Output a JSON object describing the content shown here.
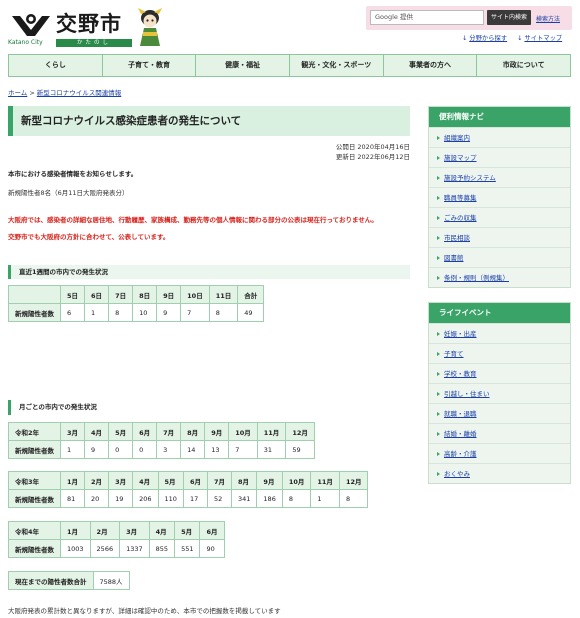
{
  "header": {
    "logo_text": "交野市",
    "logo_en": "Katano City",
    "logo_kana": "かたのし",
    "search_placeholder": "Google 提供",
    "search_button": "サイト内検索",
    "search_howto": "検索方法",
    "links": [
      "分野から探す",
      "サイトマップ"
    ]
  },
  "nav": [
    "くらし",
    "子育て・教育",
    "健康・福祉",
    "観光・文化・スポーツ",
    "事業者の方へ",
    "市政について"
  ],
  "breadcrumb": {
    "home": "ホーム",
    "sep": ">",
    "current": "新型コロナウイルス関連情報"
  },
  "page": {
    "title": "新型コロナウイルス感染症患者の発生について",
    "published": "公開日 2020年04月16日",
    "updated": "更新日 2022年06月12日",
    "lead": "本市における感染者情報をお知らせします。",
    "note": "新規陽性者8名（6月11日大阪府発表分）",
    "red1": "大阪府では、感染者の詳細な居住地、行動履歴、家族構成、勤務先等の個人情報に関わる部分の公表は現在行っておりません。",
    "red2": "交野市でも大阪府の方針に合わせて、公表しています。",
    "week_heading": "直近1週間の市内での発生状況",
    "week_table": {
      "days": [
        "5日",
        "6日",
        "7日",
        "8日",
        "9日",
        "10日",
        "11日",
        "合計"
      ],
      "label": "新規陽性者数",
      "values": [
        "6",
        "1",
        "8",
        "10",
        "9",
        "7",
        "8",
        "49"
      ]
    },
    "month_heading": "月ごとの市内での発生状況",
    "r2": {
      "year": "令和2年",
      "months": [
        "3月",
        "4月",
        "5月",
        "6月",
        "7月",
        "8月",
        "9月",
        "10月",
        "11月",
        "12月"
      ],
      "label": "新規陽性者数",
      "values": [
        "1",
        "9",
        "0",
        "0",
        "3",
        "14",
        "13",
        "7",
        "31",
        "59"
      ]
    },
    "r3": {
      "year": "令和3年",
      "months": [
        "1月",
        "2月",
        "3月",
        "4月",
        "5月",
        "6月",
        "7月",
        "8月",
        "9月",
        "10月",
        "11月",
        "12月"
      ],
      "label": "新規陽性者数",
      "values": [
        "81",
        "20",
        "19",
        "206",
        "110",
        "17",
        "52",
        "341",
        "186",
        "8",
        "1",
        "8"
      ]
    },
    "r4": {
      "year": "令和4年",
      "months": [
        "1月",
        "2月",
        "3月",
        "4月",
        "5月",
        "6月"
      ],
      "label": "新規陽性者数",
      "values": [
        "1003",
        "2566",
        "1337",
        "855",
        "551",
        "90"
      ]
    },
    "total_label": "現在までの陽性者数合計",
    "total_value": "7588人",
    "footnote": "大阪府発表の累計数と異なりますが、詳細は確認中のため、本市での把握数を掲載しています"
  },
  "sidebar": {
    "box1_title": "便利情報ナビ",
    "box1_items": [
      "組織案内",
      "施設マップ",
      "施設予約システム",
      "職員等募集",
      "ごみの収集",
      "市民相談",
      "図書館",
      "条例・規則（例規集）"
    ],
    "box2_title": "ライフイベント",
    "box2_items": [
      "妊娠・出産",
      "子育て",
      "学校・教育",
      "引越し・住まい",
      "就職・退職",
      "結婚・離婚",
      "高齢・介護",
      "おくやみ"
    ]
  },
  "colors": {
    "accent": "#3aa368",
    "nav_bg": "#e3f3e6",
    "red": "#d8231c",
    "search_bg": "#f6dde6"
  }
}
